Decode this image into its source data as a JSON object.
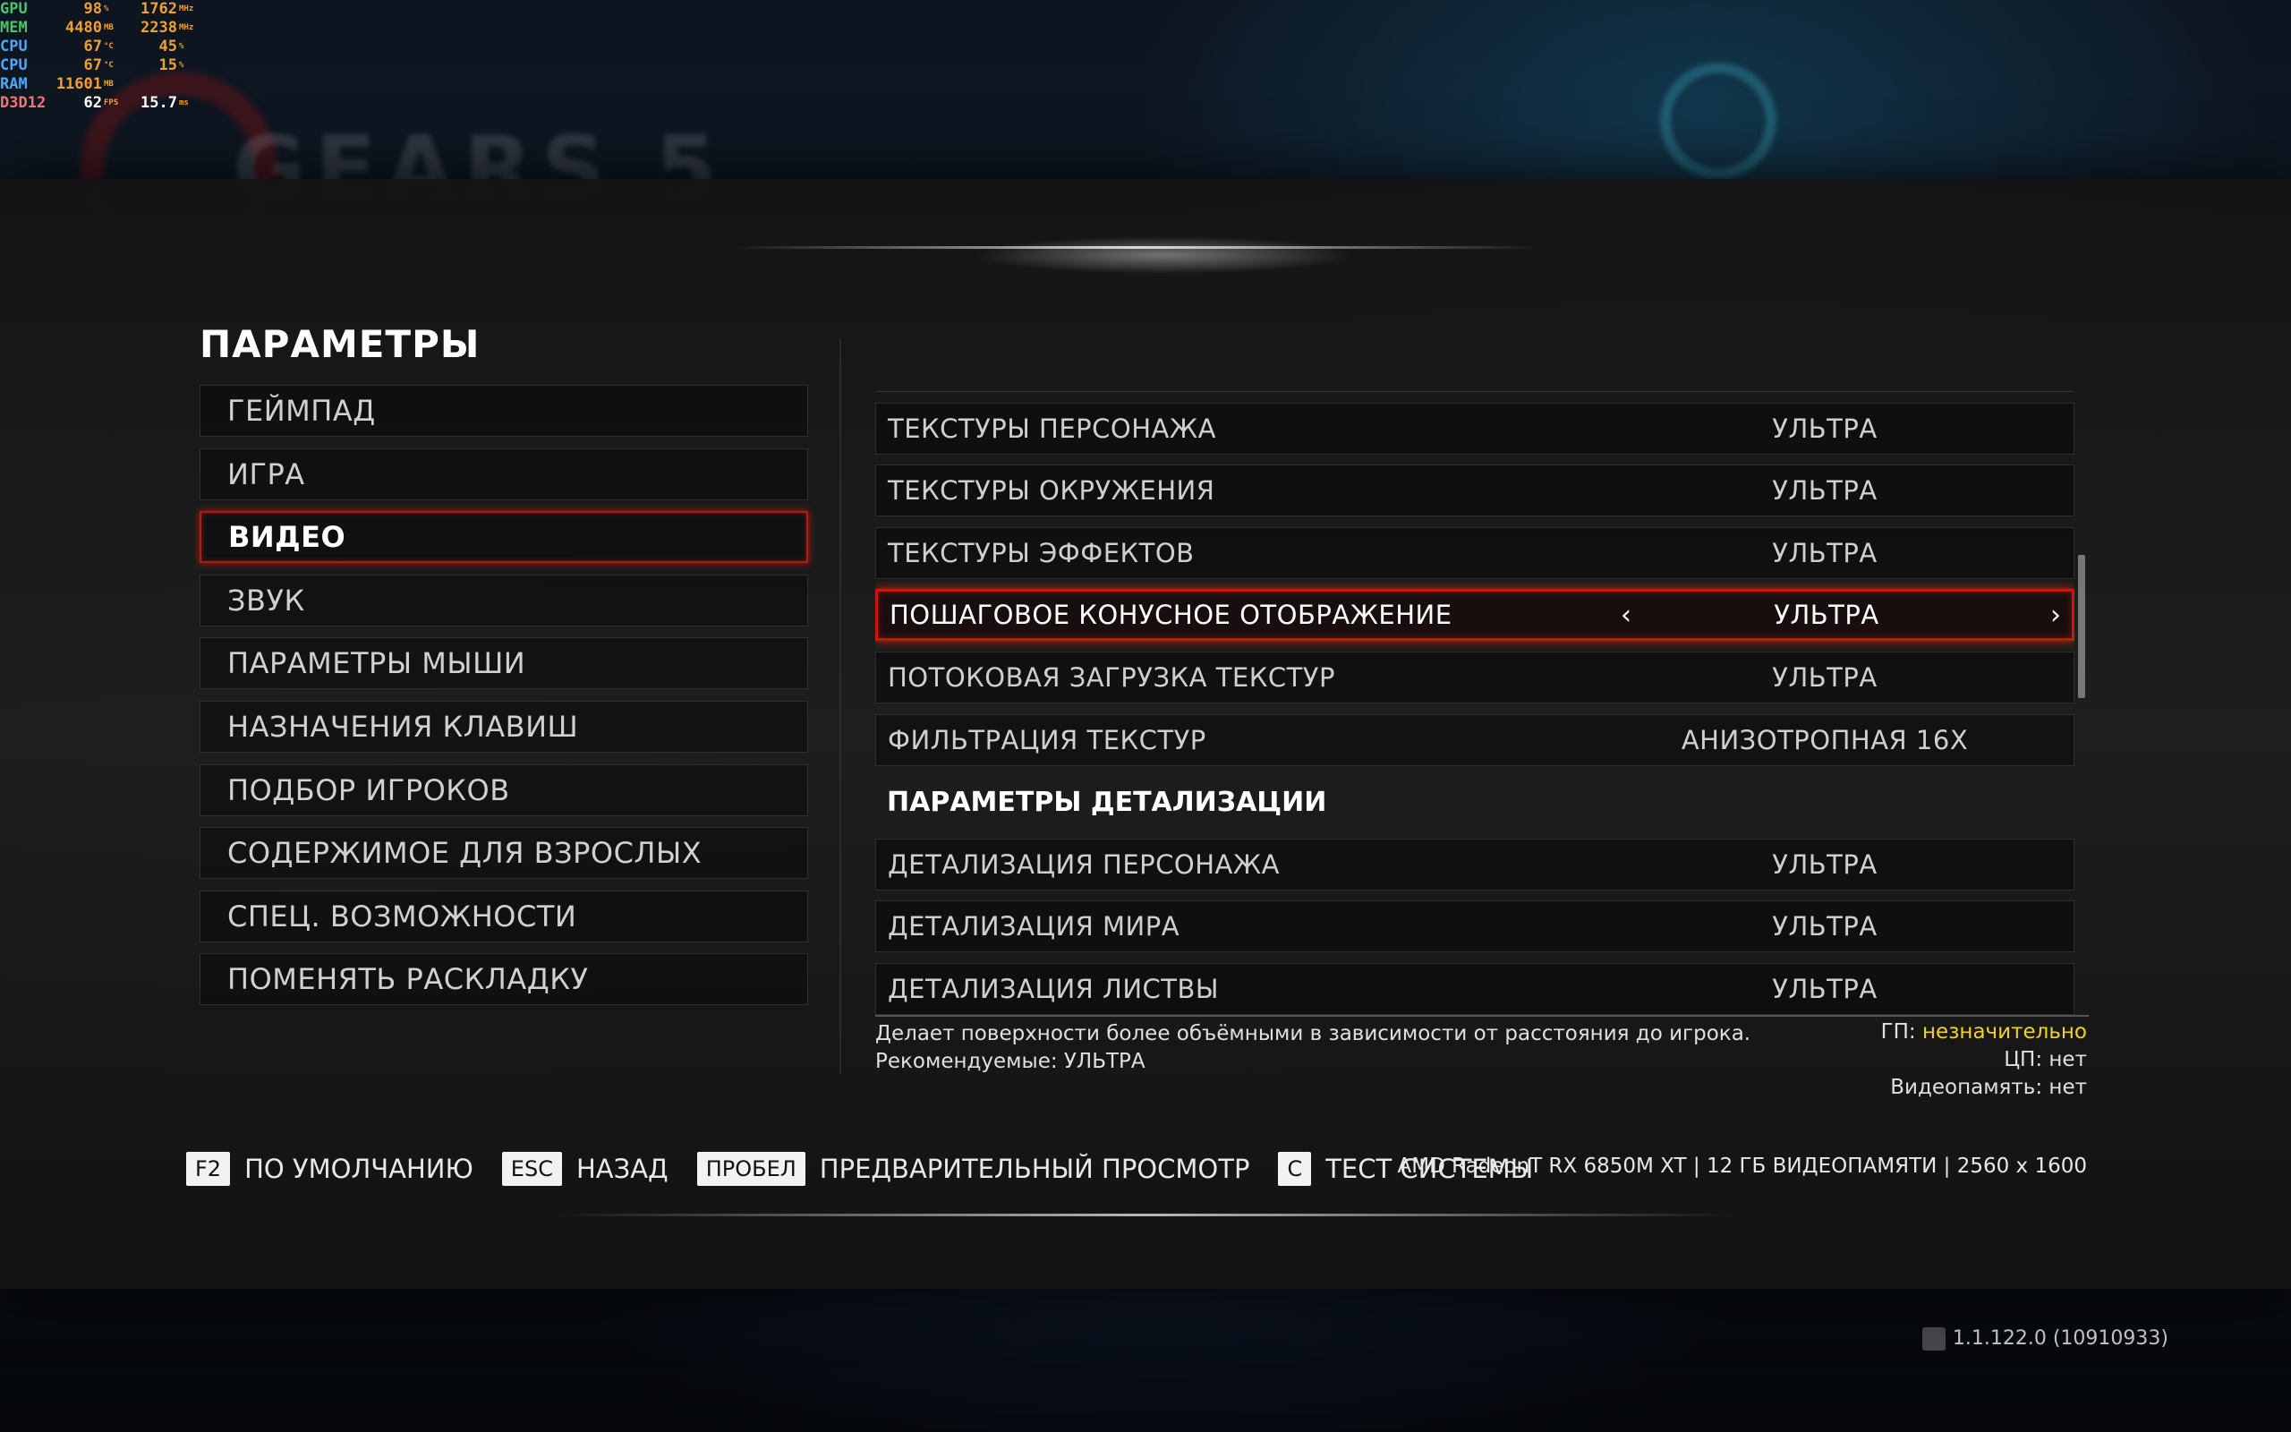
{
  "hud": [
    {
      "label": "GPU",
      "v1": "98",
      "u1": "%",
      "v2": "1762",
      "u2": "MHz",
      "cls": ""
    },
    {
      "label": "MEM",
      "v1": "4480",
      "u1": "MB",
      "v2": "2238",
      "u2": "MHz",
      "cls": ""
    },
    {
      "label": "CPU",
      "v1": "67",
      "u1": "°C",
      "v2": "45",
      "u2": "%",
      "cls": "cpu"
    },
    {
      "label": "CPU",
      "v1": "67",
      "u1": "°C",
      "v2": "15",
      "u2": "%",
      "cls": "cpu"
    },
    {
      "label": "RAM",
      "v1": "11601",
      "u1": "MB",
      "v2": "",
      "u2": "",
      "cls": "ram"
    },
    {
      "label": "D3D12",
      "v1": "62",
      "u1": "FPS",
      "v2": "15.7",
      "u2": "ms",
      "cls": "d3d"
    }
  ],
  "page_title": "ПАРАМЕТРЫ",
  "nav": [
    {
      "label": "ГЕЙМПАД",
      "active": false
    },
    {
      "label": "ИГРА",
      "active": false
    },
    {
      "label": "ВИДЕО",
      "active": true
    },
    {
      "label": "ЗВУК",
      "active": false
    },
    {
      "label": "ПАРАМЕТРЫ МЫШИ",
      "active": false
    },
    {
      "label": "НАЗНАЧЕНИЯ КЛАВИШ",
      "active": false
    },
    {
      "label": "ПОДБОР ИГРОКОВ",
      "active": false
    },
    {
      "label": "СОДЕРЖИМОЕ ДЛЯ ВЗРОСЛЫХ",
      "active": false
    },
    {
      "label": "СПЕЦ. ВОЗМОЖНОСТИ",
      "active": false
    },
    {
      "label": "ПОМЕНЯТЬ РАСКЛАДКУ",
      "active": false
    }
  ],
  "settings": [
    {
      "type": "row",
      "label": "ТЕКСТУРЫ ПЕРСОНАЖА",
      "value": "УЛЬТРА"
    },
    {
      "type": "row",
      "label": "ТЕКСТУРЫ ОКРУЖЕНИЯ",
      "value": "УЛЬТРА"
    },
    {
      "type": "row",
      "label": "ТЕКСТУРЫ ЭФФЕКТОВ",
      "value": "УЛЬТРА"
    },
    {
      "type": "row",
      "label": "ПОШАГОВОЕ КОНУСНОЕ ОТОБРАЖЕНИЕ",
      "value": "УЛЬТРА",
      "active": true
    },
    {
      "type": "row",
      "label": "ПОТОКОВАЯ ЗАГРУЗКА ТЕКСТУР",
      "value": "УЛЬТРА"
    },
    {
      "type": "row",
      "label": "ФИЛЬТРАЦИЯ ТЕКСТУР",
      "value": "АНИЗОТРОПНАЯ 16X"
    },
    {
      "type": "section",
      "label": "ПАРАМЕТРЫ ДЕТАЛИЗАЦИИ"
    },
    {
      "type": "row",
      "label": "ДЕТАЛИЗАЦИЯ ПЕРСОНАЖА",
      "value": "УЛЬТРА"
    },
    {
      "type": "row",
      "label": "ДЕТАЛИЗАЦИЯ МИРА",
      "value": "УЛЬТРА"
    },
    {
      "type": "row",
      "label": "ДЕТАЛИЗАЦИЯ ЛИСТВЫ",
      "value": "УЛЬТРА"
    }
  ],
  "arrow_left": "‹",
  "arrow_right": "›",
  "description": {
    "line1": "Делает поверхности более объёмными в зависимости от расстояния до игрока.",
    "line2": "Рекомендуемые: УЛЬТРА"
  },
  "impact": {
    "gpu_label": "ГП: ",
    "gpu_value": "незначительно",
    "cpu": "ЦП: нет",
    "vram": "Видеопамять: нет",
    "gpu_value_color": "#f5d21c"
  },
  "footer": [
    {
      "key": "F2",
      "label": "ПО УМОЛЧАНИЮ"
    },
    {
      "key": "ESC",
      "label": "НАЗАД"
    },
    {
      "key": "ПРОБЕЛ",
      "label": "ПРЕДВАРИТЕЛЬНЫЙ ПРОСМОТР"
    },
    {
      "key": "C",
      "label": "ТЕСТ СИСТЕМЫ"
    }
  ],
  "system_info": "AMD RadeonT RX 6850M XT | 12 ГБ ВИДЕОПАМЯТИ | 2560 x 1600",
  "version": "1.1.122.0 (10910933)",
  "accent_color": "#c8180c"
}
